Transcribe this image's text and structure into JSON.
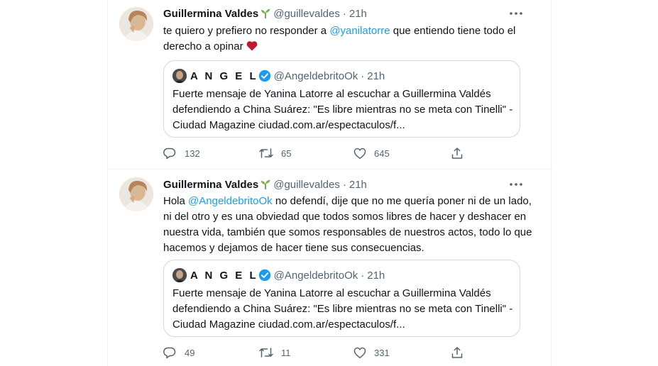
{
  "tweets": [
    {
      "author_name": "Guillermina Valdes",
      "handle": "@guillevaldes",
      "dot": "·",
      "time": "21h",
      "text_before": "te quiero y prefiero no responder a ",
      "mention": "@yanilatorre",
      "text_after": " que entiendo tiene todo el derecho a opinar",
      "quote": {
        "name": "A N G E L",
        "handle": "@AngeldebritoOk",
        "dot": "·",
        "time": "21h",
        "text": "Fuerte mensaje de Yanina Latorre al escuchar a Guillermina Valdés defendiendo a China Suárez: \"Es libre mientras no se meta con Tinelli\" - Ciudad Magazine ciudad.com.ar/espectaculos/f..."
      },
      "replies": "132",
      "retweets": "65",
      "likes": "645"
    },
    {
      "author_name": "Guillermina Valdes",
      "handle": "@guillevaldes",
      "dot": "·",
      "time": "21h",
      "text_before": "Hola ",
      "mention": "@AngeldebritoOk",
      "text_after": " no defendí, dije que no me quería poner ni de un lado, ni del otro y es una obviedad que todos somos libres de hacer y deshacer en nuestra vida, también  que somos responsables de nuestros actos, todo lo que hacemos y dejamos de hacer tiene sus consecuencias.",
      "quote": {
        "name": "A N G E L",
        "handle": "@AngeldebritoOk",
        "dot": "·",
        "time": "21h",
        "text": "Fuerte mensaje de Yanina Latorre al escuchar a Guillermina Valdés defendiendo a China Suárez: \"Es libre mientras no se meta con Tinelli\" - Ciudad Magazine ciudad.com.ar/espectaculos/f..."
      },
      "replies": "49",
      "retweets": "11",
      "likes": "331"
    }
  ],
  "icons": {
    "sprout": "seedling-emoji-icon",
    "heart_emoji": "red-heart-emoji-icon",
    "verified": "verified-badge-icon",
    "reply": "reply-icon",
    "retweet": "retweet-icon",
    "like": "like-heart-icon",
    "share": "share-icon",
    "more": "more-options-icon"
  },
  "colors": {
    "text": "#0f1419",
    "muted": "#536471",
    "link": "#1d9bf0",
    "border": "#cfd9de",
    "heart": "#be1931",
    "sprout": "#77b255"
  }
}
